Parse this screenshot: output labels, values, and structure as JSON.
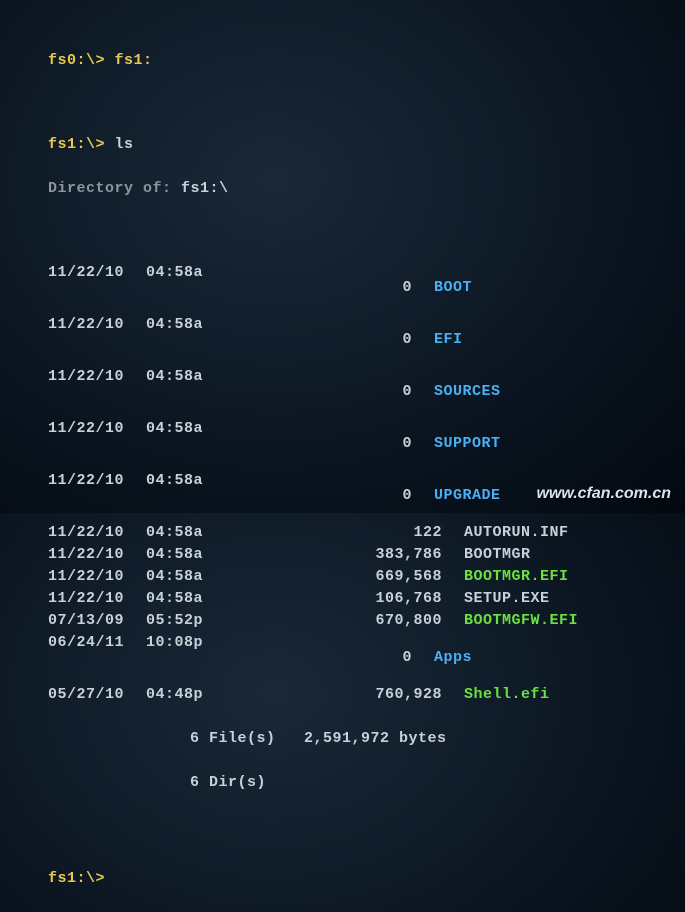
{
  "line1": {
    "prompt": "fs0:\\>",
    "cmd": "fs1:"
  },
  "line2": {
    "prompt": "fs1:\\>",
    "cmd": "ls"
  },
  "dirof_label": "Directory of:",
  "dirof_path": "fs1:\\",
  "entries": [
    {
      "date": "11/22/10",
      "time": "04:58a",
      "type": "<DIR>",
      "size": "0",
      "name": "BOOT",
      "color": "blue"
    },
    {
      "date": "11/22/10",
      "time": "04:58a",
      "type": "<DIR>",
      "size": "0",
      "name": "EFI",
      "color": "blue"
    },
    {
      "date": "11/22/10",
      "time": "04:58a",
      "type": "<DIR>",
      "size": "0",
      "name": "SOURCES",
      "color": "blue"
    },
    {
      "date": "11/22/10",
      "time": "04:58a",
      "type": "<DIR>",
      "size": "0",
      "name": "SUPPORT",
      "color": "blue"
    },
    {
      "date": "11/22/10",
      "time": "04:58a",
      "type": "<DIR>",
      "size": "0",
      "name": "UPGRADE",
      "color": "blue"
    },
    {
      "date": "11/22/10",
      "time": "04:58a",
      "type": "",
      "size": "122",
      "name": "AUTORUN.INF",
      "color": "white"
    },
    {
      "date": "11/22/10",
      "time": "04:58a",
      "type": "",
      "size": "383,786",
      "name": "BOOTMGR",
      "color": "white"
    },
    {
      "date": "11/22/10",
      "time": "04:58a",
      "type": "",
      "size": "669,568",
      "name": "BOOTMGR.EFI",
      "color": "green"
    },
    {
      "date": "11/22/10",
      "time": "04:58a",
      "type": "",
      "size": "106,768",
      "name": "SETUP.EXE",
      "color": "white"
    },
    {
      "date": "07/13/09",
      "time": "05:52p",
      "type": "",
      "size": "670,800",
      "name": "BOOTMGFW.EFI",
      "color": "green"
    },
    {
      "date": "06/24/11",
      "time": "10:08p",
      "type": "<DIR>",
      "size": "0",
      "name": "Apps",
      "color": "blue"
    },
    {
      "date": "05/27/10",
      "time": "04:48p",
      "type": "",
      "size": "760,928",
      "name": "Shell.efi",
      "color": "green"
    }
  ],
  "summary_files": "6 File(s)   2,591,972 bytes",
  "summary_dirs": "6 Dir(s)",
  "final_prompt": "fs1:\\>",
  "watermark": "www.cfan.com.cn"
}
